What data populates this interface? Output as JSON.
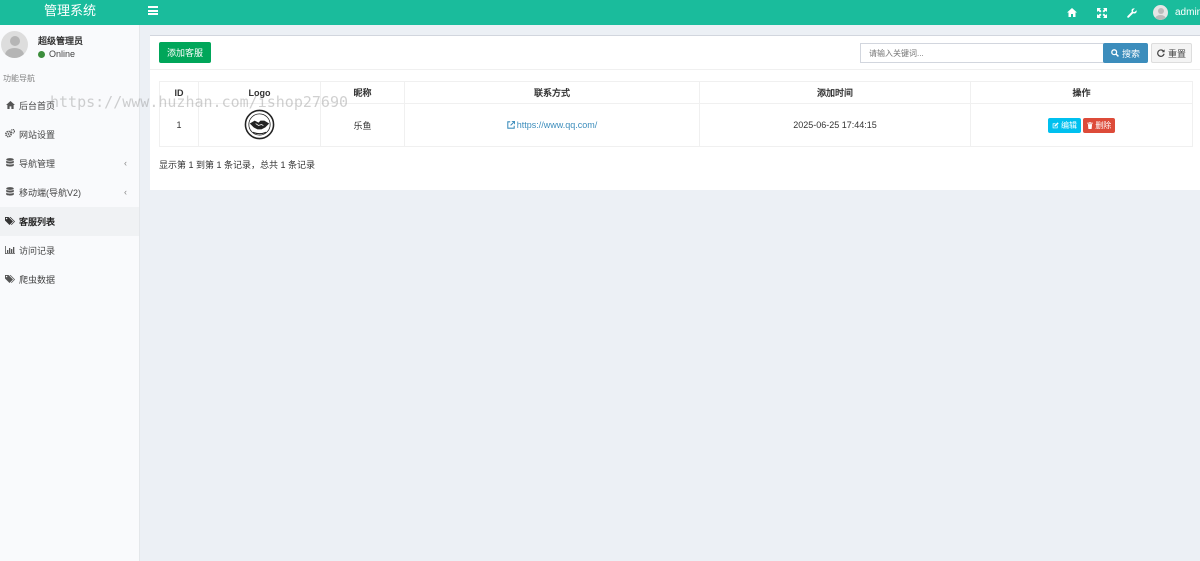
{
  "app": {
    "title": "管理系统"
  },
  "topbar": {
    "icons": [
      "home-icon",
      "expand-icon",
      "wrench-icon"
    ],
    "username": "admin"
  },
  "sidebar": {
    "user": {
      "name": "超级管理员",
      "status": "Online"
    },
    "section_header": "功能导航",
    "items": [
      {
        "label": "后台首页",
        "icon": "home-icon",
        "has_children": false,
        "active": false
      },
      {
        "label": "网站设置",
        "icon": "gears-icon",
        "has_children": false,
        "active": false
      },
      {
        "label": "导航管理",
        "icon": "database-icon",
        "has_children": true,
        "active": false
      },
      {
        "label": "移动端(导航V2)",
        "icon": "database-icon",
        "has_children": true,
        "active": false
      },
      {
        "label": "客服列表",
        "icon": "tags-icon",
        "has_children": false,
        "active": true
      },
      {
        "label": "访问记录",
        "icon": "bar-chart-icon",
        "has_children": false,
        "active": false
      },
      {
        "label": "爬虫数据",
        "icon": "tags-icon",
        "has_children": false,
        "active": false
      }
    ]
  },
  "toolbar": {
    "add_label": "添加客服",
    "search_placeholder": "请输入关键词...",
    "search_label": "搜索",
    "reset_label": "重置"
  },
  "table": {
    "columns": [
      "ID",
      "Logo",
      "昵称",
      "联系方式",
      "添加时间",
      "操作"
    ],
    "rows": [
      {
        "id": "1",
        "logo_icon": "handshake-logo",
        "nickname": "乐鱼",
        "contact": "https://www.qq.com/",
        "added_at": "2025-06-25 17:44:15",
        "edit_label": "编辑",
        "delete_label": "删除"
      }
    ]
  },
  "pagination": {
    "info": "显示第 1 到第 1 条记录，总共 1 条记录"
  },
  "watermark": "https://www.huzhan.com/ishop27690",
  "colors": {
    "topbar": "#1abc9c",
    "add_button": "#00a65a",
    "search_button": "#3c8dbc",
    "edit_button": "#00c0ef",
    "delete_button": "#dd4b39"
  }
}
